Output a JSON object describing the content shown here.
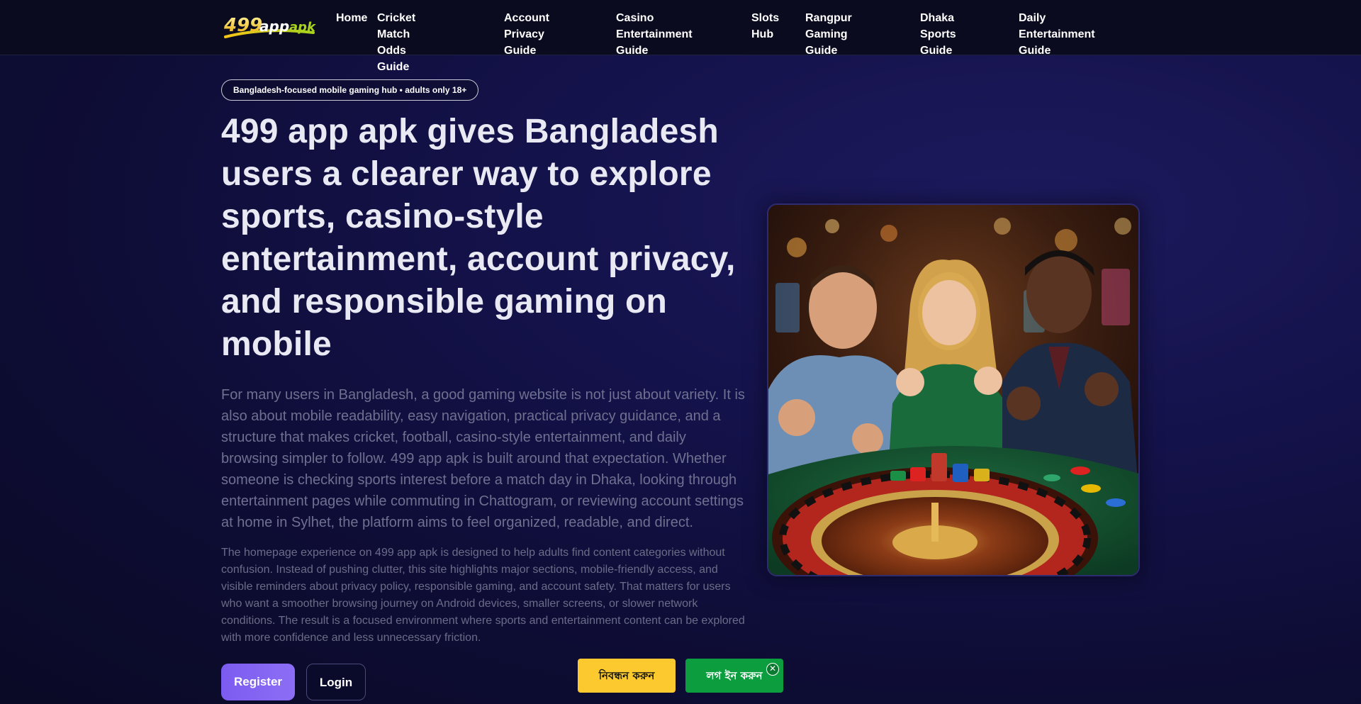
{
  "header": {
    "logo_text_a": "499",
    "logo_text_b": "app",
    "logo_text_c": "apk",
    "nav": [
      {
        "line1": "Home",
        "line2": ""
      },
      {
        "line1": "Cricket Match Odds",
        "line2": "Guide"
      },
      {
        "line1": "Account Privacy",
        "line2": "Guide"
      },
      {
        "line1": "Casino Entertainment",
        "line2": "Guide"
      },
      {
        "line1": "Slots",
        "line2": "Hub"
      },
      {
        "line1": "Rangpur Gaming",
        "line2": "Guide"
      },
      {
        "line1": "Dhaka Sports",
        "line2": "Guide"
      },
      {
        "line1": "Daily Entertainment",
        "line2": "Guide"
      }
    ]
  },
  "hero": {
    "badge": "Bangladesh-focused mobile gaming hub • adults only 18+",
    "title": "499 app apk gives Bangladesh users a clearer way to explore sports, casino-style entertainment, account privacy, and responsible gaming on mobile",
    "lead": "For many users in Bangladesh, a good gaming website is not just about variety. It is also about mobile readability, easy navigation, practical privacy guidance, and a structure that makes cricket, football, casino-style entertainment, and daily browsing simpler to follow. 499 app apk is built around that expectation. Whether someone is checking sports interest before a match day in Dhaka, looking through entertainment pages while commuting in Chattogram, or reviewing account settings at home in Sylhet, the platform aims to feel organized, readable, and direct.",
    "body": "The homepage experience on 499 app apk is designed to help adults find content categories without confusion. Instead of pushing clutter, this site highlights major sections, mobile-friendly access, and visible reminders about privacy policy, responsible gaming, and account safety. That matters for users who want a smoother browsing journey on Android devices, smaller screens, or slower network conditions. The result is a focused environment where sports and entertainment content can be explored with more confidence and less unnecessary friction.",
    "register_label": "Register",
    "login_label": "Login"
  },
  "floating": {
    "register_label": "নিবন্ধন করুন",
    "login_label": "লগ ইন করুন",
    "close_label": "✕"
  },
  "colors": {
    "accent_purple": "#7b5cf0",
    "float_register_bg": "#fcca2e",
    "float_login_bg": "#0b9d3e",
    "logo_gold": "#f5c518",
    "logo_green": "#a8d21e"
  },
  "icons": {
    "close": "close-icon"
  }
}
